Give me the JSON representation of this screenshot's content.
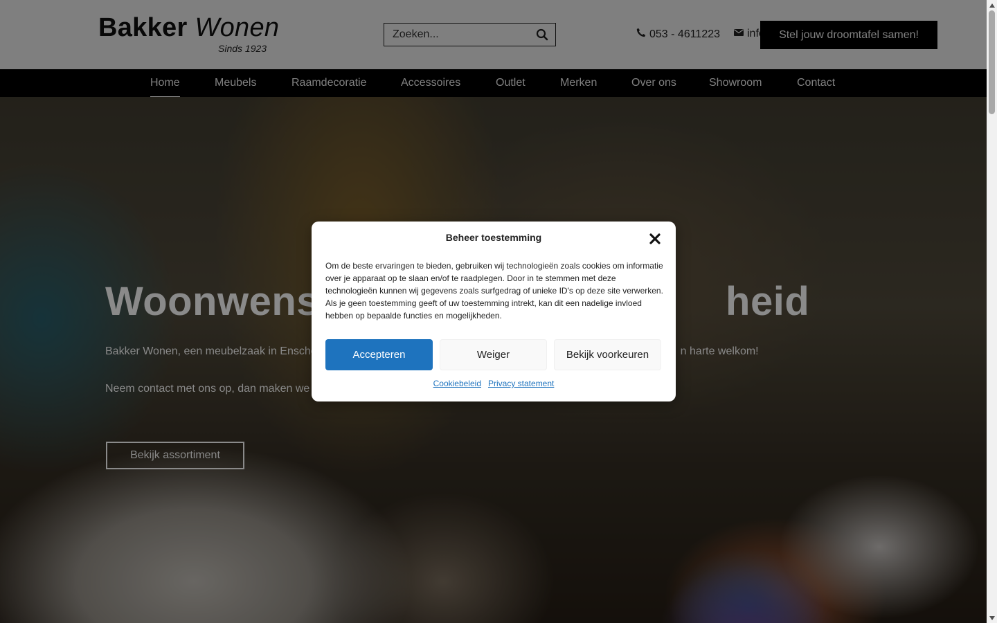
{
  "header": {
    "logo_main_bold": "Bakker",
    "logo_main_italic": "Wonen",
    "logo_sub": "Sinds 1923",
    "search_placeholder": "Zoeken...",
    "phone": "053 - 4611223",
    "email_partial": "info",
    "cta_label": "Stel jouw droomtafel samen!"
  },
  "nav": {
    "items": [
      "Home",
      "Meubels",
      "Raamdecoratie",
      "Accessoires",
      "Outlet",
      "Merken",
      "Over ons",
      "Showroom",
      "Contact"
    ],
    "active": "Home"
  },
  "hero": {
    "title_left": "Woonwens",
    "title_right": "heid",
    "text1_left": "Bakker Wonen, een meubelzaak in Ensche",
    "text1_right": "n harte welkom!",
    "text2_left": "Neem contact met ons op, dan maken we",
    "button_label": "Bekijk assortiment"
  },
  "modal": {
    "title": "Beheer toestemming",
    "body": "Om de beste ervaringen te bieden, gebruiken wij technologieën zoals cookies om informatie over je apparaat op te slaan en/of te raadplegen. Door in te stemmen met deze technologieën kunnen wij gegevens zoals surfgedrag of unieke ID's op deze site verwerken. Als je geen toestemming geeft of uw toestemming intrekt, kan dit een nadelige invloed hebben op bepaalde functies en mogelijkheden.",
    "accept_label": "Accepteren",
    "deny_label": "Weiger",
    "prefs_label": "Bekijk voorkeuren",
    "link_cookie": "Cookiebeleid",
    "link_privacy": "Privacy statement"
  },
  "colors": {
    "accept_blue": "#1e73be",
    "nav_bg": "#000000"
  }
}
